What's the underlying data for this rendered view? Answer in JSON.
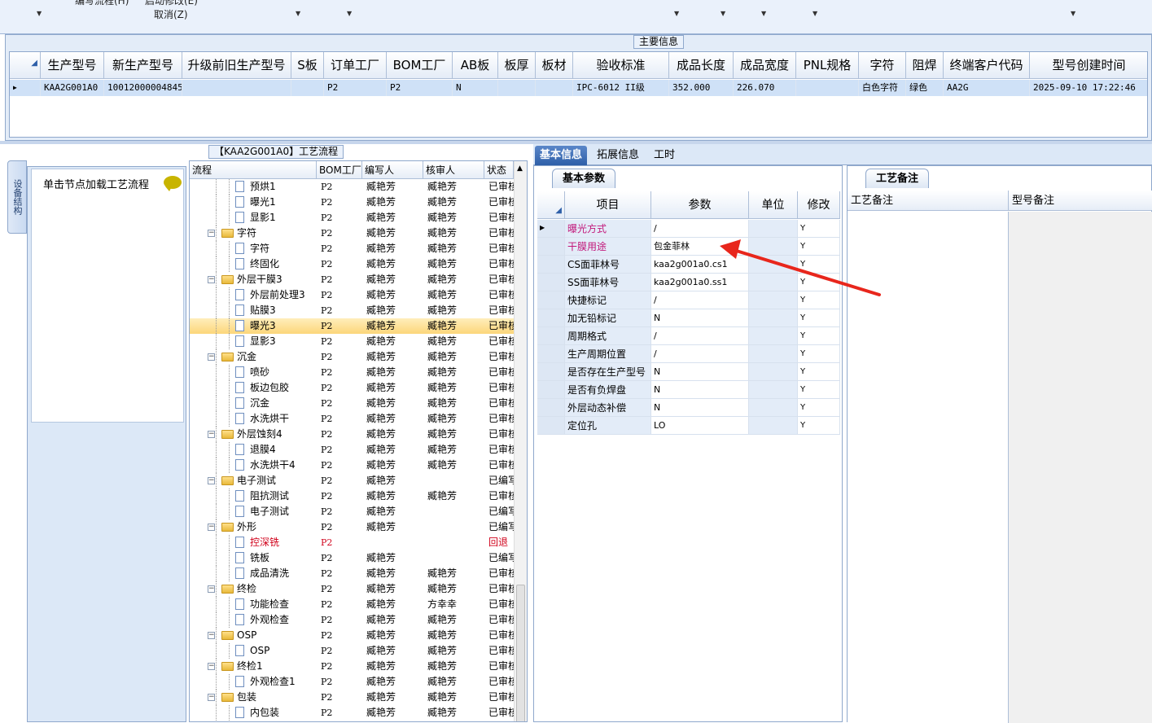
{
  "topbar": {
    "menu_cut_1": "编写流程(H)",
    "menu_cut_2": "启动修改(E)",
    "cancel": "取消(Z)"
  },
  "main_info": {
    "title": "主要信息",
    "columns": [
      "生产型号",
      "新生产型号",
      "升级前旧生产型号",
      "S板",
      "订单工厂",
      "BOM工厂",
      "AB板",
      "板厚",
      "板材",
      "验收标准",
      "成品长度",
      "成品宽度",
      "PNL规格",
      "字符",
      "阻焊",
      "终端客户代码",
      "型号创建时间"
    ],
    "row": {
      "prod_model": "KAA2G001A0",
      "new_model": "10012000004845",
      "old_model": "",
      "s_board": "",
      "order_factory": "P2",
      "bom_factory": "P2",
      "ab_board": "N",
      "thickness": "",
      "material": "",
      "standard": "IPC-6012 II级",
      "length": "352.000",
      "width": "226.070",
      "pnl": "",
      "char": "白色字符",
      "solder": "绿色",
      "customer": "AA2G",
      "created": "2025-09-10 17:22:46"
    }
  },
  "left_panel": {
    "side_tab": "设备结构",
    "load_hint": "单击节点加载工艺流程"
  },
  "flow_tree": {
    "title": "【KAA2G001A0】工艺流程",
    "columns": [
      "流程",
      "BOM工厂",
      "编写人",
      "核审人",
      "状态"
    ],
    "rows": [
      {
        "name": "预烘1",
        "level": 2,
        "factory": "P2",
        "writer": "臧艳芳",
        "reviewer": "臧艳芳",
        "status": "已审核"
      },
      {
        "name": "曝光1",
        "level": 2,
        "factory": "P2",
        "writer": "臧艳芳",
        "reviewer": "臧艳芳",
        "status": "已审核"
      },
      {
        "name": "显影1",
        "level": 2,
        "factory": "P2",
        "writer": "臧艳芳",
        "reviewer": "臧艳芳",
        "status": "已审核"
      },
      {
        "name": "字符",
        "level": 1,
        "factory": "P2",
        "writer": "臧艳芳",
        "reviewer": "臧艳芳",
        "status": "已审核"
      },
      {
        "name": "字符",
        "level": 2,
        "factory": "P2",
        "writer": "臧艳芳",
        "reviewer": "臧艳芳",
        "status": "已审核"
      },
      {
        "name": "终固化",
        "level": 2,
        "factory": "P2",
        "writer": "臧艳芳",
        "reviewer": "臧艳芳",
        "status": "已审核"
      },
      {
        "name": "外层干膜3",
        "level": 1,
        "factory": "P2",
        "writer": "臧艳芳",
        "reviewer": "臧艳芳",
        "status": "已审核"
      },
      {
        "name": "外层前处理3",
        "level": 2,
        "factory": "P2",
        "writer": "臧艳芳",
        "reviewer": "臧艳芳",
        "status": "已审核"
      },
      {
        "name": "贴膜3",
        "level": 2,
        "factory": "P2",
        "writer": "臧艳芳",
        "reviewer": "臧艳芳",
        "status": "已审核"
      },
      {
        "name": "曝光3",
        "level": 2,
        "factory": "P2",
        "writer": "臧艳芳",
        "reviewer": "臧艳芳",
        "status": "已审核",
        "selected": true
      },
      {
        "name": "显影3",
        "level": 2,
        "factory": "P2",
        "writer": "臧艳芳",
        "reviewer": "臧艳芳",
        "status": "已审核"
      },
      {
        "name": "沉金",
        "level": 1,
        "factory": "P2",
        "writer": "臧艳芳",
        "reviewer": "臧艳芳",
        "status": "已审核"
      },
      {
        "name": "喷砂",
        "level": 2,
        "factory": "P2",
        "writer": "臧艳芳",
        "reviewer": "臧艳芳",
        "status": "已审核"
      },
      {
        "name": "板边包胶",
        "level": 2,
        "factory": "P2",
        "writer": "臧艳芳",
        "reviewer": "臧艳芳",
        "status": "已审核"
      },
      {
        "name": "沉金",
        "level": 2,
        "factory": "P2",
        "writer": "臧艳芳",
        "reviewer": "臧艳芳",
        "status": "已审核"
      },
      {
        "name": "水洗烘干",
        "level": 2,
        "factory": "P2",
        "writer": "臧艳芳",
        "reviewer": "臧艳芳",
        "status": "已审核"
      },
      {
        "name": "外层蚀刻4",
        "level": 1,
        "factory": "P2",
        "writer": "臧艳芳",
        "reviewer": "臧艳芳",
        "status": "已审核"
      },
      {
        "name": "退膜4",
        "level": 2,
        "factory": "P2",
        "writer": "臧艳芳",
        "reviewer": "臧艳芳",
        "status": "已审核"
      },
      {
        "name": "水洗烘干4",
        "level": 2,
        "factory": "P2",
        "writer": "臧艳芳",
        "reviewer": "臧艳芳",
        "status": "已审核"
      },
      {
        "name": "电子测试",
        "level": 1,
        "factory": "P2",
        "writer": "臧艳芳",
        "reviewer": "",
        "status": "已编写"
      },
      {
        "name": "阻抗测试",
        "level": 2,
        "factory": "P2",
        "writer": "臧艳芳",
        "reviewer": "臧艳芳",
        "status": "已审核"
      },
      {
        "name": "电子测试",
        "level": 2,
        "factory": "P2",
        "writer": "臧艳芳",
        "reviewer": "",
        "status": "已编写"
      },
      {
        "name": "外形",
        "level": 1,
        "factory": "P2",
        "writer": "臧艳芳",
        "reviewer": "",
        "status": "已编写"
      },
      {
        "name": "控深铣",
        "level": 2,
        "factory": "P2",
        "writer": "",
        "reviewer": "",
        "status": "回退",
        "red": true
      },
      {
        "name": "铣板",
        "level": 2,
        "factory": "P2",
        "writer": "臧艳芳",
        "reviewer": "",
        "status": "已编写"
      },
      {
        "name": "成品清洗",
        "level": 2,
        "factory": "P2",
        "writer": "臧艳芳",
        "reviewer": "臧艳芳",
        "status": "已审核"
      },
      {
        "name": "终检",
        "level": 1,
        "factory": "P2",
        "writer": "臧艳芳",
        "reviewer": "臧艳芳",
        "status": "已审核"
      },
      {
        "name": "功能检查",
        "level": 2,
        "factory": "P2",
        "writer": "臧艳芳",
        "reviewer": "方幸幸",
        "status": "已审核"
      },
      {
        "name": "外观检查",
        "level": 2,
        "factory": "P2",
        "writer": "臧艳芳",
        "reviewer": "臧艳芳",
        "status": "已审核"
      },
      {
        "name": "OSP",
        "level": 1,
        "factory": "P2",
        "writer": "臧艳芳",
        "reviewer": "臧艳芳",
        "status": "已审核"
      },
      {
        "name": "OSP",
        "level": 2,
        "factory": "P2",
        "writer": "臧艳芳",
        "reviewer": "臧艳芳",
        "status": "已审核"
      },
      {
        "name": "终检1",
        "level": 1,
        "factory": "P2",
        "writer": "臧艳芳",
        "reviewer": "臧艳芳",
        "status": "已审核"
      },
      {
        "name": "外观检查1",
        "level": 2,
        "factory": "P2",
        "writer": "臧艳芳",
        "reviewer": "臧艳芳",
        "status": "已审核"
      },
      {
        "name": "包装",
        "level": 1,
        "factory": "P2",
        "writer": "臧艳芳",
        "reviewer": "臧艳芳",
        "status": "已审核"
      },
      {
        "name": "内包装",
        "level": 2,
        "factory": "P2",
        "writer": "臧艳芳",
        "reviewer": "臧艳芳",
        "status": "已审核"
      }
    ]
  },
  "right_tabs": [
    "基本信息",
    "拓展信息",
    "工时"
  ],
  "basic_params": {
    "tab": "基本参数",
    "columns": [
      "项目",
      "参数",
      "单位",
      "修改"
    ],
    "rows": [
      {
        "item": "曝光方式",
        "value": "/",
        "unit": "",
        "edit": "Y",
        "pink": true
      },
      {
        "item": "干膜用途",
        "value": "包金菲林",
        "unit": "",
        "edit": "Y",
        "pink": true
      },
      {
        "item": "CS面菲林号",
        "value": "kaa2g001a0.cs1",
        "unit": "",
        "edit": "Y"
      },
      {
        "item": "SS面菲林号",
        "value": "kaa2g001a0.ss1",
        "unit": "",
        "edit": "Y"
      },
      {
        "item": "快捷标记",
        "value": "/",
        "unit": "",
        "edit": "Y"
      },
      {
        "item": "加无铅标记",
        "value": "N",
        "unit": "",
        "edit": "Y"
      },
      {
        "item": "周期格式",
        "value": "/",
        "unit": "",
        "edit": "Y"
      },
      {
        "item": "生产周期位置",
        "value": "/",
        "unit": "",
        "edit": "Y"
      },
      {
        "item": "是否存在生产型号",
        "value": "N",
        "unit": "",
        "edit": "Y"
      },
      {
        "item": "是否有负焊盘",
        "value": "N",
        "unit": "",
        "edit": "Y"
      },
      {
        "item": "外层动态补偿",
        "value": "N",
        "unit": "",
        "edit": "Y"
      },
      {
        "item": "定位孔",
        "value": "LO",
        "unit": "",
        "edit": "Y"
      }
    ]
  },
  "notes": {
    "tab": "工艺备注",
    "col1": "工艺备注",
    "col2": "型号备注"
  },
  "colors": {
    "arrow": "#e8261c",
    "pink": "#c2187a",
    "selected_row": "#cfe1f7",
    "active_tab": "#2e5fa8"
  }
}
